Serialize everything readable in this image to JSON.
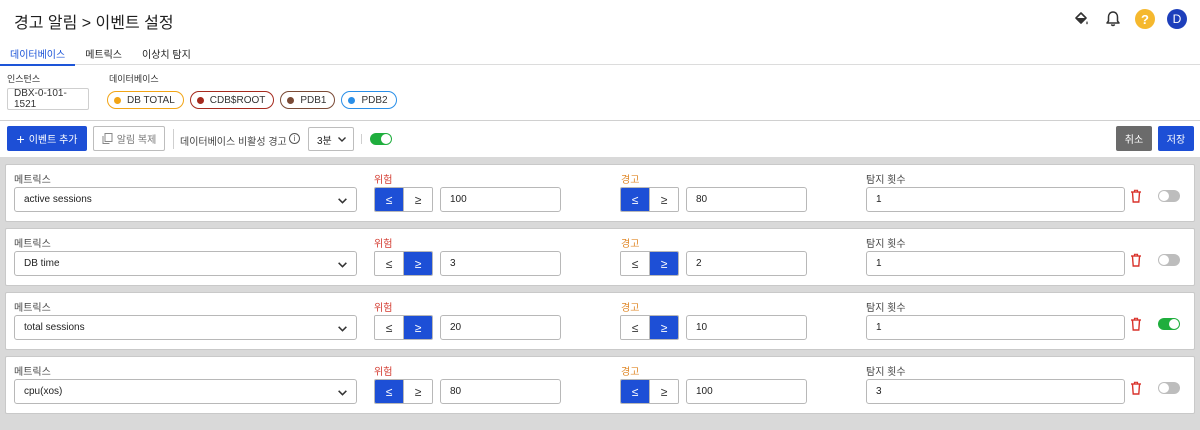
{
  "header": {
    "title": "경고 알림 > 이벤트 설정",
    "avatar_letter": "D",
    "help_symbol": "?",
    "icons": [
      "paint-bucket-icon",
      "bell-icon",
      "help-icon",
      "avatar"
    ]
  },
  "tabs": [
    {
      "label": "데이터베이스",
      "active": true
    },
    {
      "label": "메트릭스",
      "active": false
    },
    {
      "label": "이상치 탐지",
      "active": false
    }
  ],
  "filters": {
    "instance_label": "인스턴스",
    "instance_value": "DBX-0-101-1521",
    "database_label": "데이터베이스",
    "databases": [
      {
        "label": "DB TOTAL",
        "color": "#f2a516"
      },
      {
        "label": "CDB$ROOT",
        "color": "#a52a1e"
      },
      {
        "label": "PDB1",
        "color": "#7a4a36"
      },
      {
        "label": "PDB2",
        "color": "#2a8fe8"
      }
    ]
  },
  "toolbar": {
    "add_event_label": "이벤트 추가",
    "copy_alert_label": "알림 복제",
    "inactive_alert_label": "데이터베이스 비활성 경고",
    "interval_value": "3분",
    "inactive_toggle_on": true,
    "cancel_label": "취소",
    "save_label": "저장"
  },
  "rule_labels": {
    "metric": "메트릭스",
    "danger": "위험",
    "warning": "경고",
    "count": "탐지 횟수",
    "le_symbol": "≤",
    "ge_symbol": "≥"
  },
  "rules": [
    {
      "metric": "active sessions",
      "danger_op": "le",
      "danger_value": "100",
      "warning_op": "le",
      "warning_value": "80",
      "count": "1",
      "enabled": false
    },
    {
      "metric": "DB time",
      "danger_op": "ge",
      "danger_value": "3",
      "warning_op": "ge",
      "warning_value": "2",
      "count": "1",
      "enabled": false
    },
    {
      "metric": "total sessions",
      "danger_op": "ge",
      "danger_value": "20",
      "warning_op": "ge",
      "warning_value": "10",
      "count": "1",
      "enabled": true
    },
    {
      "metric": "cpu(xos)",
      "danger_op": "le",
      "danger_value": "80",
      "warning_op": "le",
      "warning_value": "100",
      "count": "3",
      "enabled": false
    }
  ],
  "colors": {
    "primary": "#1d4fd6",
    "danger_text": "#d33a2f",
    "warning_text": "#e0892a",
    "toggle_on": "#1fae3d",
    "toggle_off": "#bdbdbd",
    "trash": "#d9322b"
  }
}
